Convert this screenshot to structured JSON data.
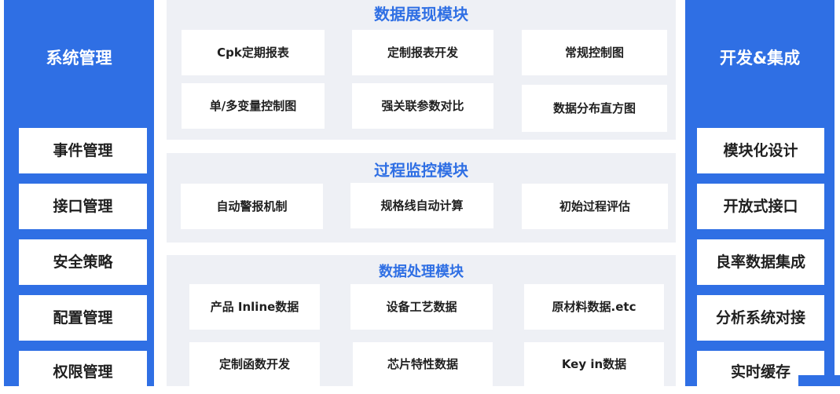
{
  "left": {
    "title": "系统管理",
    "items": [
      "事件管理",
      "接口管理",
      "安全策略",
      "配置管理",
      "权限管理"
    ]
  },
  "right": {
    "title": "开发&集成",
    "items": [
      "模块化设计",
      "开放式接口",
      "良率数据集成",
      "分析系统对接",
      "实时缓存"
    ]
  },
  "modules": {
    "display": {
      "title": "数据展现模块",
      "cards": [
        "Cpk定期报表",
        "定制报表开发",
        "常规控制图",
        "单/多变量控制图",
        "强关联参数对比",
        "数据分布直方图"
      ]
    },
    "monitor": {
      "title": "过程监控模块",
      "cards": [
        "自动警报机制",
        "规格线自动计算",
        "初始过程评估"
      ]
    },
    "process": {
      "title": "数据处理模块",
      "cards": [
        "产品 Inline数据",
        "设备工艺数据",
        "原材料数据.etc",
        "定制函数开发",
        "芯片特性数据",
        "Key in数据"
      ]
    }
  },
  "colors": {
    "accent": "#2f6fe4",
    "module_bg": "#eef0f5",
    "card_bg": "#ffffff",
    "text": "#1f1f1f"
  }
}
